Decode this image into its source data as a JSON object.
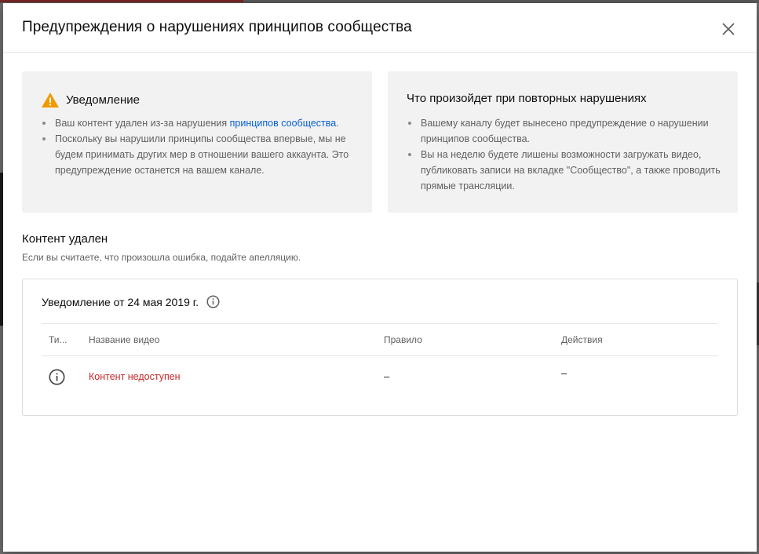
{
  "dialog": {
    "title": "Предупреждения о нарушениях принципов сообщества",
    "close_icon": "close-icon"
  },
  "notice_card": {
    "heading": "Уведомление",
    "icon": "warning-icon",
    "icon_color": "#f29900",
    "item1_before": "Ваш контент удален из-за нарушения ",
    "item1_link": "принципов сообщества",
    "item1_after": ".",
    "item2": "Поскольку вы нарушили принципы сообщества впервые, мы не будем принимать других мер в отношении вашего аккаунта. Это предупреждение останется на вашем канале."
  },
  "repeat_card": {
    "heading": "Что произойдет при повторных нарушениях",
    "items": [
      "Вашему каналу будет вынесено предупреждение о нарушении принципов сообщества.",
      "Вы на неделю будете лишены возможности загружать видео, публиковать записи на вкладке \"Сообщество\", а также проводить прямые трансляции."
    ]
  },
  "removed_section": {
    "title": "Контент удален",
    "subtitle": "Если вы считаете, что произошла ошибка, подайте апелляцию."
  },
  "notice_table": {
    "title": "Уведомление от 24 мая 2019 г.",
    "info_icon": "info-icon",
    "columns": [
      "Ти...",
      "Название видео",
      "Правило",
      "Действия"
    ],
    "rows": [
      {
        "type_icon": "info-icon",
        "video_title": "Контент недоступен",
        "rule": "–",
        "action": "–"
      }
    ]
  },
  "colors": {
    "link": "#065fd4",
    "error_text": "#c62828",
    "card_bg": "#f2f2f2"
  }
}
